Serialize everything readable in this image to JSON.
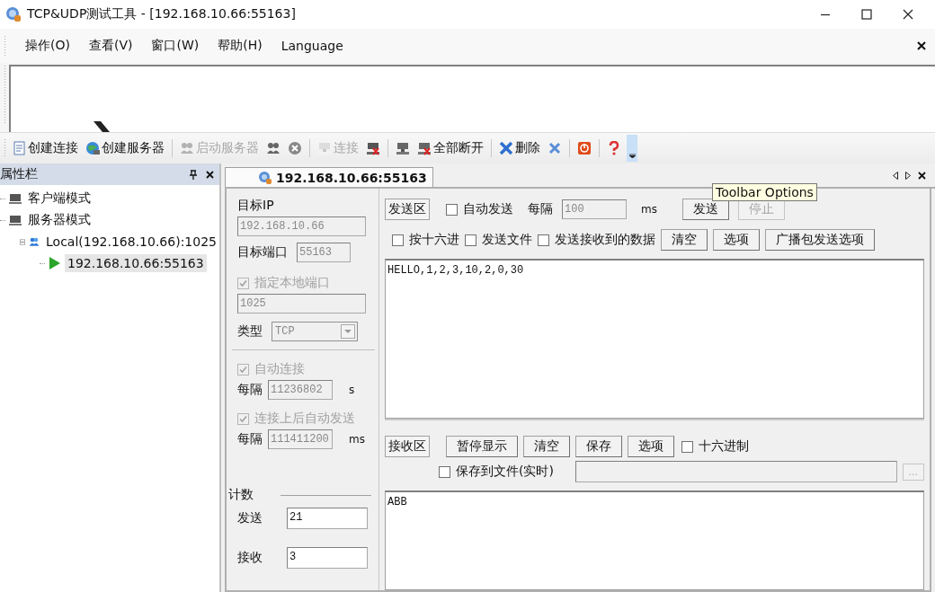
{
  "window": {
    "title": "TCP&UDP测试工具 - [192.168.10.66:55163]"
  },
  "menu": {
    "items": [
      {
        "label": "操作(O)"
      },
      {
        "label": "查看(V)"
      },
      {
        "label": "窗口(W)"
      },
      {
        "label": "帮助(H)"
      },
      {
        "label": "Language"
      }
    ]
  },
  "toolbar": {
    "items": [
      {
        "kind": "button",
        "label": "创建连接",
        "disabled": false
      },
      {
        "kind": "button",
        "label": "创建服务器",
        "disabled": false
      },
      {
        "kind": "separator"
      },
      {
        "kind": "button",
        "label": "启动服务器",
        "disabled": true
      },
      {
        "kind": "button"
      },
      {
        "kind": "button"
      },
      {
        "kind": "separator"
      },
      {
        "kind": "button",
        "label": "连接",
        "disabled": true
      },
      {
        "kind": "button"
      },
      {
        "kind": "separator"
      },
      {
        "kind": "button"
      },
      {
        "kind": "button",
        "label": "全部断开",
        "disabled": false
      },
      {
        "kind": "separator"
      },
      {
        "kind": "button",
        "label": "删除",
        "disabled": false
      },
      {
        "kind": "button"
      },
      {
        "kind": "separator"
      },
      {
        "kind": "button"
      },
      {
        "kind": "separator"
      },
      {
        "kind": "button"
      },
      {
        "kind": "overflow",
        "highlighted": true
      }
    ]
  },
  "tooltip": {
    "text": "Toolbar Options"
  },
  "properties_panel": {
    "title": "属性栏",
    "tree": [
      {
        "label": "客户端模式",
        "selected": false
      },
      {
        "label": "服务器模式",
        "selected": false,
        "children": [
          {
            "label": "Local(192.168.10.66):1025",
            "selected": false,
            "expanded": true,
            "children": [
              {
                "label": "192.168.10.66:55163",
                "selected": true
              }
            ]
          }
        ]
      }
    ]
  },
  "document_tabs": [
    {
      "label": "192.168.10.66:55163",
      "selected": true
    }
  ],
  "connection": {
    "disabled": true,
    "target_ip": {
      "label": "目标IP",
      "value": "192.168.10.66"
    },
    "target_port": {
      "label": "目标端口",
      "value": "55163"
    },
    "local_port": {
      "label": "指定本地端口",
      "checked": true,
      "value": "1025"
    },
    "type": {
      "label": "类型",
      "value": "TCP"
    },
    "auto_connect": {
      "label": "自动连接",
      "checked": true,
      "interval_label": "每隔",
      "interval": "11236802",
      "unit": "s"
    },
    "auto_send": {
      "label": "连接上后自动发送",
      "checked": true,
      "interval_label": "每隔",
      "interval": "111411200",
      "unit": "ms"
    }
  },
  "counts": {
    "title": "计数",
    "sent_label": "发送",
    "sent": "21",
    "received_label": "接收",
    "received": "3"
  },
  "send": {
    "title": "发送区",
    "auto_send": {
      "label": "自动发送",
      "checked": false
    },
    "interval_label": "每隔",
    "interval": "100",
    "interval_disabled": true,
    "unit": "ms",
    "send_button": {
      "label": "发送",
      "disabled": false
    },
    "stop_button": {
      "label": "停止",
      "disabled": true
    },
    "options": [
      {
        "label": "按十六进",
        "checked": false
      },
      {
        "label": "发送文件",
        "checked": false
      },
      {
        "label": "发送接收到的数据",
        "checked": false
      }
    ],
    "buttons": [
      {
        "label": "清空"
      },
      {
        "label": "选项"
      },
      {
        "label": "广播包发送选项"
      }
    ],
    "text": "HELLO,1,2,3,10,2,0,30"
  },
  "receive": {
    "title": "接收区",
    "buttons": [
      {
        "label": "暂停显示"
      },
      {
        "label": "清空"
      },
      {
        "label": "保存"
      },
      {
        "label": "选项"
      }
    ],
    "hex": {
      "label": "十六进制",
      "checked": false
    },
    "save_to_file": {
      "label": "保存到文件(实时)",
      "checked": false
    },
    "path_field": {
      "disabled": true
    },
    "browse_button": {
      "label": "..."
    },
    "text": "ABB"
  }
}
